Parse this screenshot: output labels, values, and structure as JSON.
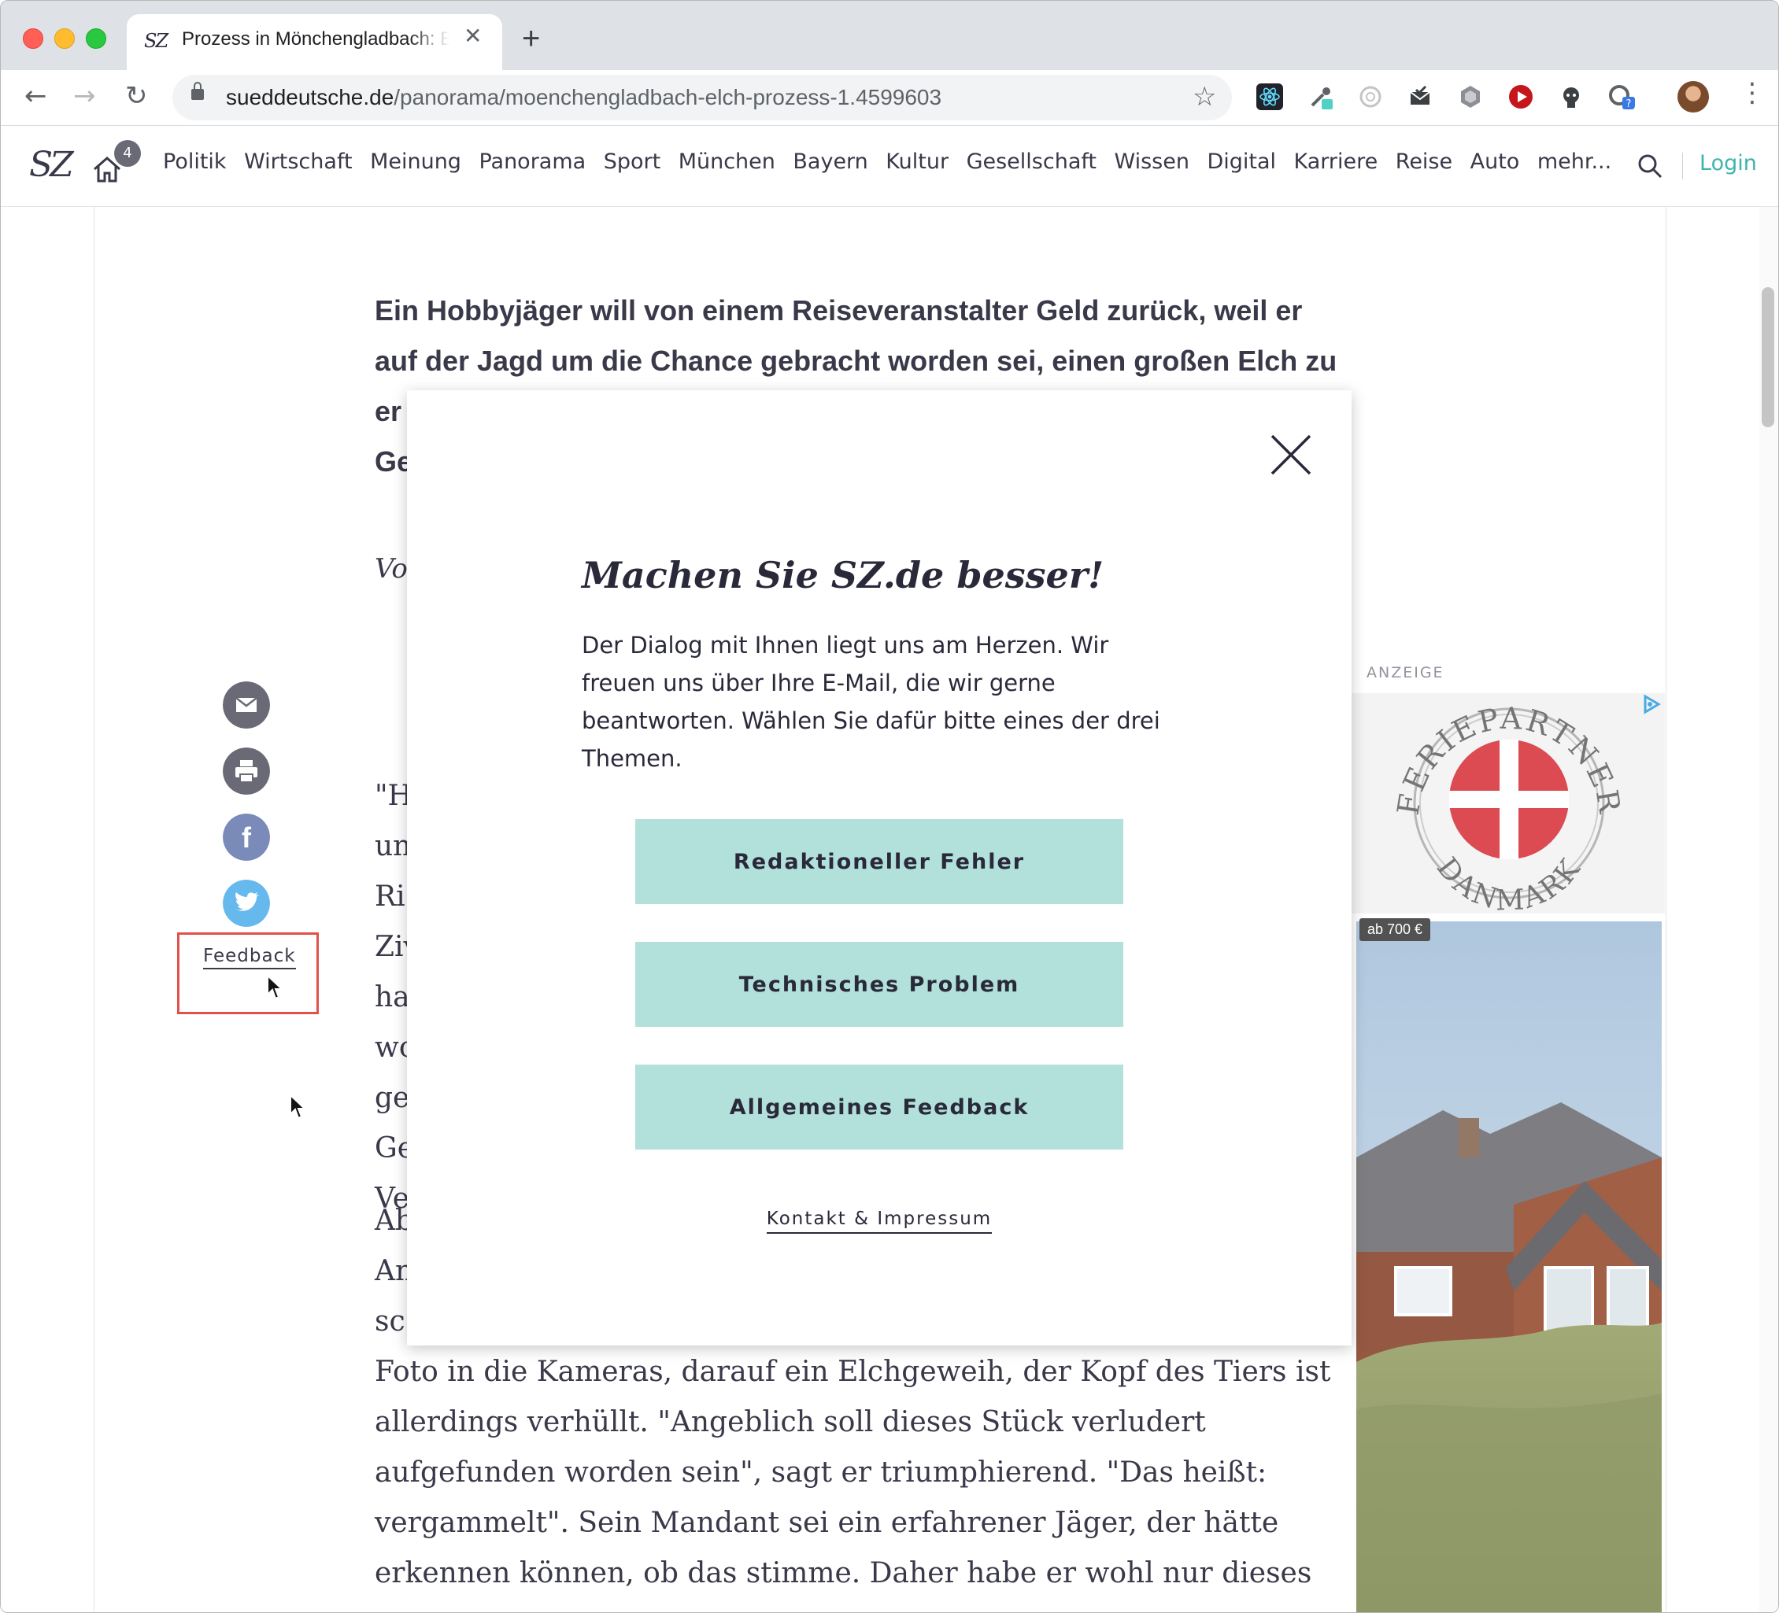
{
  "browser": {
    "tab_title": "Prozess in Mönchengladbach: Elch",
    "tab_favicon": "SZ",
    "url_host": "sueddeutsche.de",
    "url_path": "/panorama/moenchengladbach-elch-prozess-1.4599603",
    "extensions": [
      "react-devtools-icon",
      "eyedropper-icon",
      "ring-icon",
      "mail-check-icon",
      "hexagon-icon",
      "play-red-icon",
      "octocat-icon",
      "help-badge-icon"
    ]
  },
  "site": {
    "logo": "SZ",
    "home_badge": "4",
    "nav": [
      "Politik",
      "Wirtschaft",
      "Meinung",
      "Panorama",
      "Sport",
      "München",
      "Bayern",
      "Kultur",
      "Gesellschaft",
      "Wissen",
      "Digital",
      "Karriere",
      "Reise",
      "Auto",
      "mehr..."
    ],
    "login": "Login",
    "accent_color": "#2eafa4"
  },
  "article": {
    "lead_lines": [
      "Ein Hobbyjäger will von einem Reiseveranstalter Geld zurück, weil er",
      "auf der Jagd um die Chance gebracht worden sei, einen großen Elch zu",
      "er",
      "Ge"
    ],
    "author_fragment": "Vo",
    "para1_fragments": [
      "\"H",
      "un",
      "Ri",
      "Ziv",
      "ha",
      "wo",
      "ge",
      "Ge",
      "Ve"
    ],
    "para2_fragments": [
      "Ab",
      "An",
      "sc"
    ],
    "body_lines": [
      "Foto in die Kameras, darauf ein Elchgeweih, der Kopf des Tiers ist",
      "allerdings verhüllt. \"Angeblich soll dieses Stück verludert",
      "aufgefunden worden sein\", sagt er triumphierend. \"Das heißt:",
      "vergammelt\". Sein Mandant sei ein erfahrener Jäger, der hätte",
      "erkennen können, ob das stimme. Daher habe er wohl nur dieses"
    ],
    "feedback_label": "Feedback"
  },
  "ad": {
    "label": "ANZEIGE",
    "logo_text_top": "FERIEPARTNER",
    "logo_text_bottom": "DANMARK",
    "price_tag": "ab 700 €"
  },
  "modal": {
    "title": "Machen Sie SZ.de besser!",
    "description": "Der Dialog mit Ihnen liegt uns am Herzen. Wir freuen uns über Ihre E-Mail, die wir gerne beantworten. Wählen Sie dafür bitte eines der drei Themen.",
    "buttons": [
      "Redaktioneller Fehler",
      "Technisches Problem",
      "Allgemeines Feedback"
    ],
    "link": "Kontakt & Impressum",
    "button_color": "#b2e0da"
  }
}
